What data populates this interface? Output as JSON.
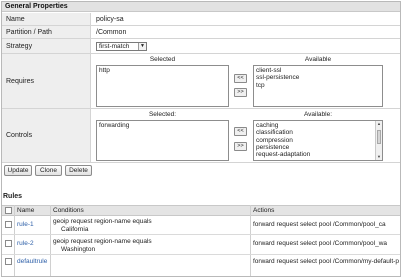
{
  "general": {
    "title": "General Properties",
    "name_label": "Name",
    "name_value": "policy-sa",
    "partition_label": "Partition / Path",
    "partition_value": "/Common",
    "strategy_label": "Strategy",
    "strategy_value": "first-match"
  },
  "requires": {
    "label": "Requires",
    "selected_header": "Selected",
    "available_header": "Available",
    "selected": [
      "http"
    ],
    "available": [
      "client-ssl",
      "ssl-persistence",
      "tcp"
    ],
    "add_label": "<<",
    "remove_label": ">>"
  },
  "controls": {
    "label": "Controls",
    "selected_header": "Selected:",
    "available_header": "Available:",
    "selected": [
      "forwarding"
    ],
    "available": [
      "caching",
      "classification",
      "compression",
      "persistence",
      "request-adaptation"
    ],
    "add_label": "<<",
    "remove_label": ">>"
  },
  "buttons": {
    "update": "Update",
    "clone": "Clone",
    "delete": "Delete"
  },
  "rules": {
    "title": "Rules",
    "col_name": "Name",
    "col_conditions": "Conditions",
    "col_actions": "Actions",
    "rows": [
      {
        "name": "rule-1",
        "cond1": "geoip request region-name equals",
        "cond2": "California",
        "action": "forward request select pool /Common/pool_ca"
      },
      {
        "name": "rule-2",
        "cond1": "geoip request region-name equals",
        "cond2": "Washington",
        "action": "forward request select pool /Common/pool_wa"
      },
      {
        "name": "defaultrule",
        "cond1": "",
        "cond2": "",
        "action": "forward request select pool /Common/my-default-pool"
      }
    ]
  }
}
